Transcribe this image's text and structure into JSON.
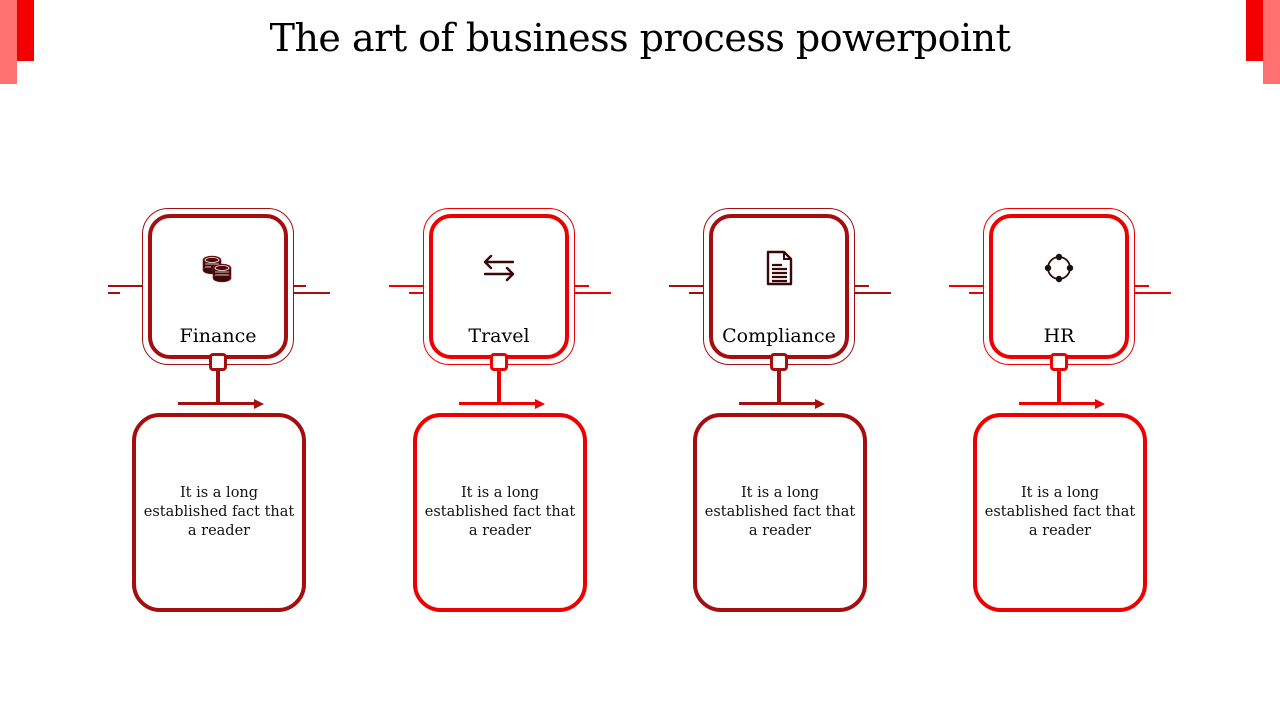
{
  "title": "The art of business process powerpoint",
  "colors": {
    "dark_red": "#A50E0E",
    "bright_red": "#EE0000",
    "corner_red": "#F50000",
    "corner_pink": "#FF7070",
    "icon_dark": "#3A0808"
  },
  "steps": [
    {
      "label": "Finance",
      "icon": "coins-icon",
      "description": "It is a long established fact that a reader",
      "color": "#A50E0E"
    },
    {
      "label": "Travel",
      "icon": "exchange-arrows-icon",
      "description": "It is a long established fact that a reader",
      "color": "#EE0000"
    },
    {
      "label": "Compliance",
      "icon": "document-icon",
      "description": "It is a long established fact that a reader",
      "color": "#A50E0E"
    },
    {
      "label": "HR",
      "icon": "network-circle-icon",
      "description": "It is a long established fact that a reader",
      "color": "#EE0000"
    }
  ]
}
